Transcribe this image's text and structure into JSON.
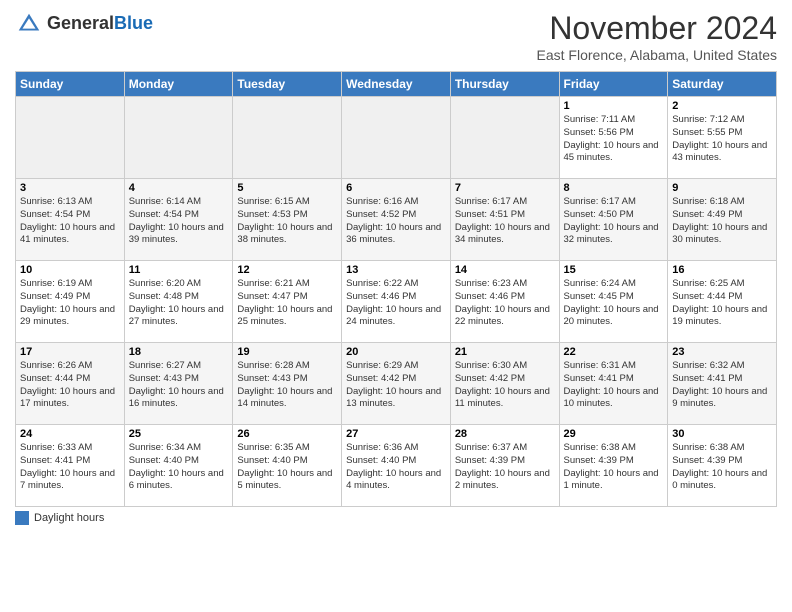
{
  "header": {
    "logo_general": "General",
    "logo_blue": "Blue",
    "title": "November 2024",
    "subtitle": "East Florence, Alabama, United States"
  },
  "footer": {
    "legend_label": "Daylight hours"
  },
  "weekdays": [
    "Sunday",
    "Monday",
    "Tuesday",
    "Wednesday",
    "Thursday",
    "Friday",
    "Saturday"
  ],
  "weeks": [
    [
      {
        "day": "",
        "info": ""
      },
      {
        "day": "",
        "info": ""
      },
      {
        "day": "",
        "info": ""
      },
      {
        "day": "",
        "info": ""
      },
      {
        "day": "",
        "info": ""
      },
      {
        "day": "1",
        "info": "Sunrise: 7:11 AM\nSunset: 5:56 PM\nDaylight: 10 hours and 45 minutes."
      },
      {
        "day": "2",
        "info": "Sunrise: 7:12 AM\nSunset: 5:55 PM\nDaylight: 10 hours and 43 minutes."
      }
    ],
    [
      {
        "day": "3",
        "info": "Sunrise: 6:13 AM\nSunset: 4:54 PM\nDaylight: 10 hours and 41 minutes."
      },
      {
        "day": "4",
        "info": "Sunrise: 6:14 AM\nSunset: 4:54 PM\nDaylight: 10 hours and 39 minutes."
      },
      {
        "day": "5",
        "info": "Sunrise: 6:15 AM\nSunset: 4:53 PM\nDaylight: 10 hours and 38 minutes."
      },
      {
        "day": "6",
        "info": "Sunrise: 6:16 AM\nSunset: 4:52 PM\nDaylight: 10 hours and 36 minutes."
      },
      {
        "day": "7",
        "info": "Sunrise: 6:17 AM\nSunset: 4:51 PM\nDaylight: 10 hours and 34 minutes."
      },
      {
        "day": "8",
        "info": "Sunrise: 6:17 AM\nSunset: 4:50 PM\nDaylight: 10 hours and 32 minutes."
      },
      {
        "day": "9",
        "info": "Sunrise: 6:18 AM\nSunset: 4:49 PM\nDaylight: 10 hours and 30 minutes."
      }
    ],
    [
      {
        "day": "10",
        "info": "Sunrise: 6:19 AM\nSunset: 4:49 PM\nDaylight: 10 hours and 29 minutes."
      },
      {
        "day": "11",
        "info": "Sunrise: 6:20 AM\nSunset: 4:48 PM\nDaylight: 10 hours and 27 minutes."
      },
      {
        "day": "12",
        "info": "Sunrise: 6:21 AM\nSunset: 4:47 PM\nDaylight: 10 hours and 25 minutes."
      },
      {
        "day": "13",
        "info": "Sunrise: 6:22 AM\nSunset: 4:46 PM\nDaylight: 10 hours and 24 minutes."
      },
      {
        "day": "14",
        "info": "Sunrise: 6:23 AM\nSunset: 4:46 PM\nDaylight: 10 hours and 22 minutes."
      },
      {
        "day": "15",
        "info": "Sunrise: 6:24 AM\nSunset: 4:45 PM\nDaylight: 10 hours and 20 minutes."
      },
      {
        "day": "16",
        "info": "Sunrise: 6:25 AM\nSunset: 4:44 PM\nDaylight: 10 hours and 19 minutes."
      }
    ],
    [
      {
        "day": "17",
        "info": "Sunrise: 6:26 AM\nSunset: 4:44 PM\nDaylight: 10 hours and 17 minutes."
      },
      {
        "day": "18",
        "info": "Sunrise: 6:27 AM\nSunset: 4:43 PM\nDaylight: 10 hours and 16 minutes."
      },
      {
        "day": "19",
        "info": "Sunrise: 6:28 AM\nSunset: 4:43 PM\nDaylight: 10 hours and 14 minutes."
      },
      {
        "day": "20",
        "info": "Sunrise: 6:29 AM\nSunset: 4:42 PM\nDaylight: 10 hours and 13 minutes."
      },
      {
        "day": "21",
        "info": "Sunrise: 6:30 AM\nSunset: 4:42 PM\nDaylight: 10 hours and 11 minutes."
      },
      {
        "day": "22",
        "info": "Sunrise: 6:31 AM\nSunset: 4:41 PM\nDaylight: 10 hours and 10 minutes."
      },
      {
        "day": "23",
        "info": "Sunrise: 6:32 AM\nSunset: 4:41 PM\nDaylight: 10 hours and 9 minutes."
      }
    ],
    [
      {
        "day": "24",
        "info": "Sunrise: 6:33 AM\nSunset: 4:41 PM\nDaylight: 10 hours and 7 minutes."
      },
      {
        "day": "25",
        "info": "Sunrise: 6:34 AM\nSunset: 4:40 PM\nDaylight: 10 hours and 6 minutes."
      },
      {
        "day": "26",
        "info": "Sunrise: 6:35 AM\nSunset: 4:40 PM\nDaylight: 10 hours and 5 minutes."
      },
      {
        "day": "27",
        "info": "Sunrise: 6:36 AM\nSunset: 4:40 PM\nDaylight: 10 hours and 4 minutes."
      },
      {
        "day": "28",
        "info": "Sunrise: 6:37 AM\nSunset: 4:39 PM\nDaylight: 10 hours and 2 minutes."
      },
      {
        "day": "29",
        "info": "Sunrise: 6:38 AM\nSunset: 4:39 PM\nDaylight: 10 hours and 1 minute."
      },
      {
        "day": "30",
        "info": "Sunrise: 6:38 AM\nSunset: 4:39 PM\nDaylight: 10 hours and 0 minutes."
      }
    ]
  ]
}
